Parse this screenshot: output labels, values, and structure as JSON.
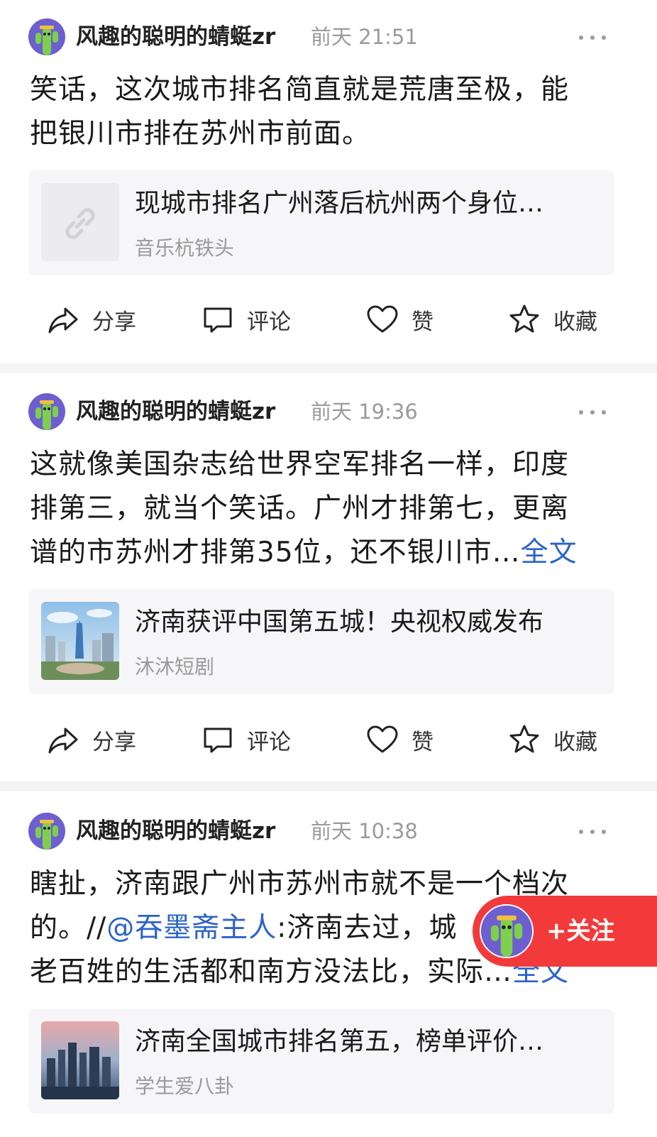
{
  "posts": [
    {
      "username": "风趣的聪明的蜻蜓zr",
      "time": "前天  21:51",
      "content_lines": [
        "笑话，这次城市排名简直就是荒唐至极，能",
        "把银川市排在苏州市前面。"
      ],
      "card": {
        "title": "现城市排名广州落后杭州两个身位…",
        "source": "音乐杭铁头",
        "thumb": "link-icon"
      }
    },
    {
      "username": "风趣的聪明的蜻蜓zr",
      "time": "前天  19:36",
      "content_lines": [
        "这就像美国杂志给世界空军排名一样，印度",
        "排第三，就当个笑话。广州才排第七，更离",
        "谱的市苏州才排第35位，还不银川市…"
      ],
      "full_text_link": "全文",
      "card": {
        "title": "济南获评中国第五城！央视权威发布",
        "source": "沐沐短剧",
        "thumb": "city-photo-tower"
      }
    },
    {
      "username": "风趣的聪明的蜻蜓zr",
      "time": "前天  10:38",
      "content_line_1": "瞎扯，济南跟广州市苏州市就不是一个档次",
      "content_line_2_prefix": "的。//",
      "mention": "@吞墨斋主人",
      "content_line_2_suffix": ":济南去过，城",
      "content_line_3": "老百姓的生活都和南方没法比，实际…",
      "full_text_link": "全文",
      "card": {
        "title": "济南全国城市排名第五，榜单评价…",
        "source": "学生爱八卦",
        "thumb": "city-photo-skyline"
      }
    }
  ],
  "actions": {
    "share": "分享",
    "comment": "评论",
    "like": "赞",
    "favorite": "收藏"
  },
  "follow_button": {
    "label": "+关注"
  },
  "colors": {
    "link_blue": "#2b63c9",
    "follow_red": "#f23a3a",
    "avatar_purple": "#6d5fd0",
    "cactus_green": "#7ecf4e"
  }
}
